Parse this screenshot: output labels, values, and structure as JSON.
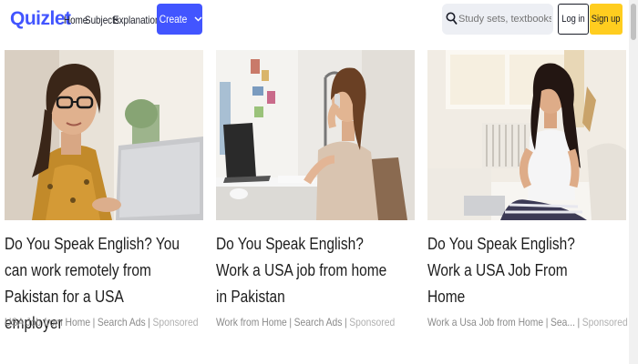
{
  "header": {
    "logo": "Quizlet",
    "nav": [
      "Home",
      "Subjects",
      "Explanations"
    ],
    "create_label": "Create",
    "search_placeholder": "Study sets, textbooks, ...",
    "login_label": "Log in",
    "signup_label": "Sign up"
  },
  "colors": {
    "brand": "#4255ff",
    "signup": "#ffcd1f"
  },
  "cards": [
    {
      "headline": "Do You Speak English? You can work remotely from Pakistan for a USA employer",
      "source": "USA Job from Home",
      "category": "Search Ads",
      "sponsored": "Sponsored"
    },
    {
      "headline": "Do You Speak English? Work a USA job from home in Pakistan",
      "source": "Work from Home",
      "category": "Search Ads",
      "sponsored": "Sponsored"
    },
    {
      "headline": "Do You Speak English? Work a USA Job From Home",
      "source": "Work a Usa Job from Home",
      "category": "Sea...",
      "sponsored": "Sponsored"
    }
  ]
}
